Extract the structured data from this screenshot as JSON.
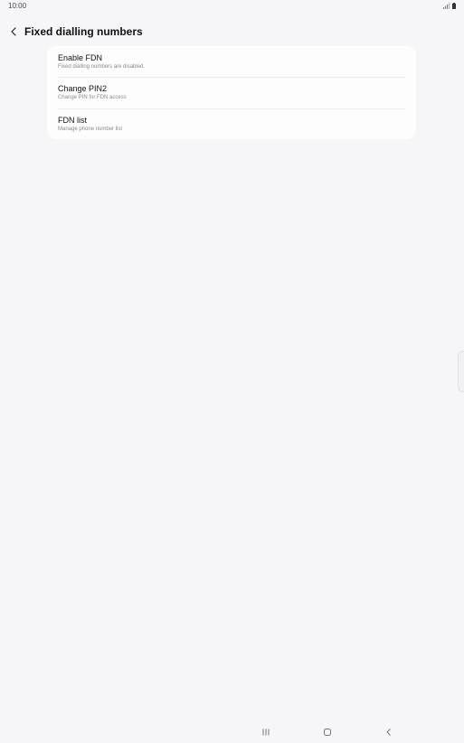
{
  "status_bar": {
    "time": "10:00",
    "icons": [
      "signal-icon",
      "battery-icon"
    ]
  },
  "header": {
    "back_icon": "chevron-left-icon",
    "title": "Fixed dialling numbers"
  },
  "settings": {
    "items": [
      {
        "title": "Enable FDN",
        "subtitle": "Fixed dialling numbers are disabled."
      },
      {
        "title": "Change PIN2",
        "subtitle": "Change PIN for FDN access"
      },
      {
        "title": "FDN list",
        "subtitle": "Manage phone number list"
      }
    ]
  },
  "nav_bar": {
    "buttons": [
      "recent-apps-icon",
      "home-icon",
      "back-icon"
    ]
  },
  "colors": {
    "background": "#f6f6f8",
    "card": "#fdfdfe",
    "subtitle": "#8a8a8a"
  }
}
